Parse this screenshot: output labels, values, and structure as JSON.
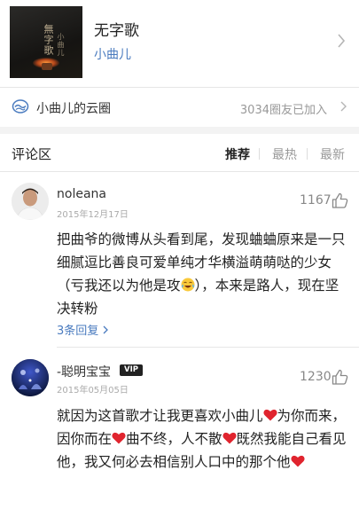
{
  "song": {
    "title": "无字歌",
    "artist": "小曲儿"
  },
  "circle": {
    "label": "小曲儿的云圈",
    "count_text": "3034圈友已加入"
  },
  "comments_section": {
    "title": "评论区",
    "sort_tabs": [
      "推荐",
      "最热",
      "最新"
    ],
    "active_tab": "推荐"
  },
  "comments": [
    {
      "nickname": "noleana",
      "date": "2015年12月17日",
      "likes": "1167",
      "text_part1": "把曲爷的微博从头看到尾，发现蛐蛐原来是一只细腻逗比善良可爱单纯才华横溢萌萌哒的少女（亏我还以为他是攻",
      "text_part2": "），本来是路人，现在坚决转粉",
      "emoji": "laughing-tears-emoji",
      "replies_text": "3条回复"
    },
    {
      "nickname": "-聪明宝宝",
      "vip_badge": "VIP",
      "date": "2015年05月05日",
      "likes": "1230",
      "seg1": "就因为这首歌才让我更喜欢小曲儿",
      "seg2": "为你而来，因你而在",
      "seg3": "曲不终，人不散",
      "seg4": "既然我能自己看见他，我又何必去相信别人口中的那个他",
      "emoji": "red-heart-emoji"
    }
  ],
  "colors": {
    "link_blue": "#4a7bbf",
    "heart_red": "#e0242e",
    "muted_gray": "#999999"
  }
}
